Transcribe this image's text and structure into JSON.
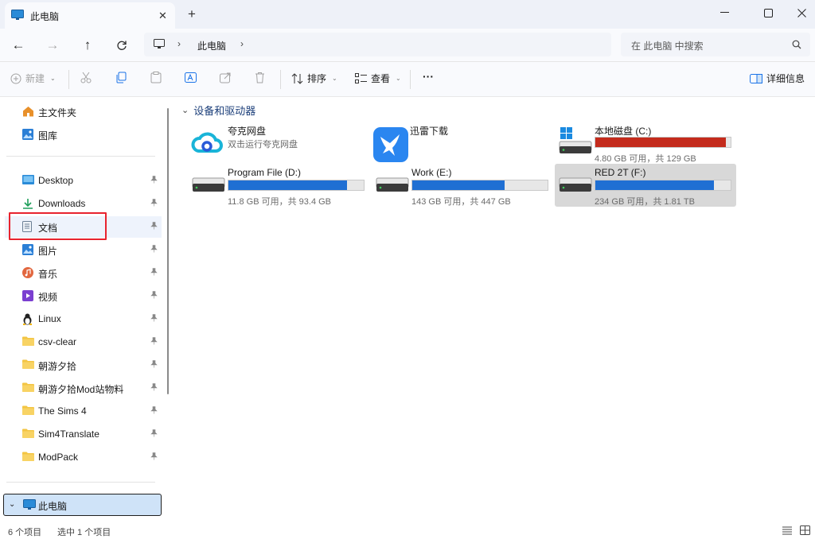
{
  "colors": {
    "accent": "#1a73e8",
    "drive_bar_blue": "#1f6fd3",
    "drive_bar_red": "#c42b1c",
    "annotation_red": "#e8232e",
    "selection": "#cfe3f8"
  },
  "tab": {
    "title": "此电脑",
    "close_icon": "close-icon",
    "new_tab_label": "+"
  },
  "window": {
    "minimize_icon": "minimize-icon",
    "maximize_icon": "maximize-icon",
    "close_icon": "close-icon"
  },
  "address": {
    "back_icon": "arrow-left-icon",
    "forward_icon": "arrow-right-icon",
    "up_icon": "arrow-up-icon",
    "refresh_icon": "refresh-icon",
    "location": "此电脑",
    "search_placeholder": "在 此电脑 中搜索"
  },
  "toolbar": {
    "new_label": "新建",
    "sort_label": "排序",
    "view_label": "查看",
    "more_label": "···",
    "details_label": "详细信息",
    "icons": [
      "cut-icon",
      "copy-icon",
      "paste-icon",
      "rename-icon",
      "share-icon",
      "delete-icon"
    ]
  },
  "sidebar": {
    "top_items": [
      {
        "label": "主文件夹",
        "icon": "home-icon"
      },
      {
        "label": "图库",
        "icon": "gallery-icon"
      }
    ],
    "pinned": [
      {
        "label": "Desktop",
        "icon": "desktop-icon"
      },
      {
        "label": "Downloads",
        "icon": "download-icon"
      },
      {
        "label": "文档",
        "icon": "document-icon"
      },
      {
        "label": "图片",
        "icon": "pictures-icon"
      },
      {
        "label": "音乐",
        "icon": "music-icon"
      },
      {
        "label": "视频",
        "icon": "video-icon"
      },
      {
        "label": "Linux",
        "icon": "linux-icon"
      },
      {
        "label": "csv-clear",
        "icon": "folder-icon"
      },
      {
        "label": "朝游夕拾",
        "icon": "folder-icon"
      },
      {
        "label": "朝游夕拾Mod站物料",
        "icon": "folder-icon"
      },
      {
        "label": "The Sims 4",
        "icon": "folder-icon"
      },
      {
        "label": "Sim4Translate",
        "icon": "folder-icon"
      },
      {
        "label": "ModPack",
        "icon": "folder-icon"
      }
    ],
    "this_pc": "此电脑"
  },
  "content": {
    "group_title": "设备和驱动器",
    "apps": [
      {
        "name": "夸克网盘",
        "subtitle": "双击运行夸克网盘",
        "icon": "cloud-drive-icon"
      },
      {
        "name": "迅雷下载",
        "icon": "xunlei-icon"
      }
    ],
    "drives": [
      {
        "name": "本地磁盘 (C:)",
        "free": "4.80 GB 可用，共 129 GB",
        "used_fraction": 0.963,
        "color": "#c42b1c",
        "icon": "windows-drive-icon",
        "selected": false
      },
      {
        "name": "Program File (D:)",
        "free": "11.8 GB 可用，共 93.4 GB",
        "used_fraction": 0.874,
        "color": "#1f6fd3",
        "icon": "hard-drive-icon",
        "selected": false
      },
      {
        "name": "Work (E:)",
        "free": "143 GB 可用，共 447 GB",
        "used_fraction": 0.68,
        "color": "#1f6fd3",
        "icon": "hard-drive-icon",
        "selected": false
      },
      {
        "name": "RED 2T (F:)",
        "free": "234 GB 可用，共 1.81 TB",
        "used_fraction": 0.874,
        "color": "#1f6fd3",
        "icon": "hard-drive-icon",
        "selected": true
      }
    ]
  },
  "status": {
    "item_count": "6 个项目",
    "selected_count": "选中 1 个项目"
  }
}
